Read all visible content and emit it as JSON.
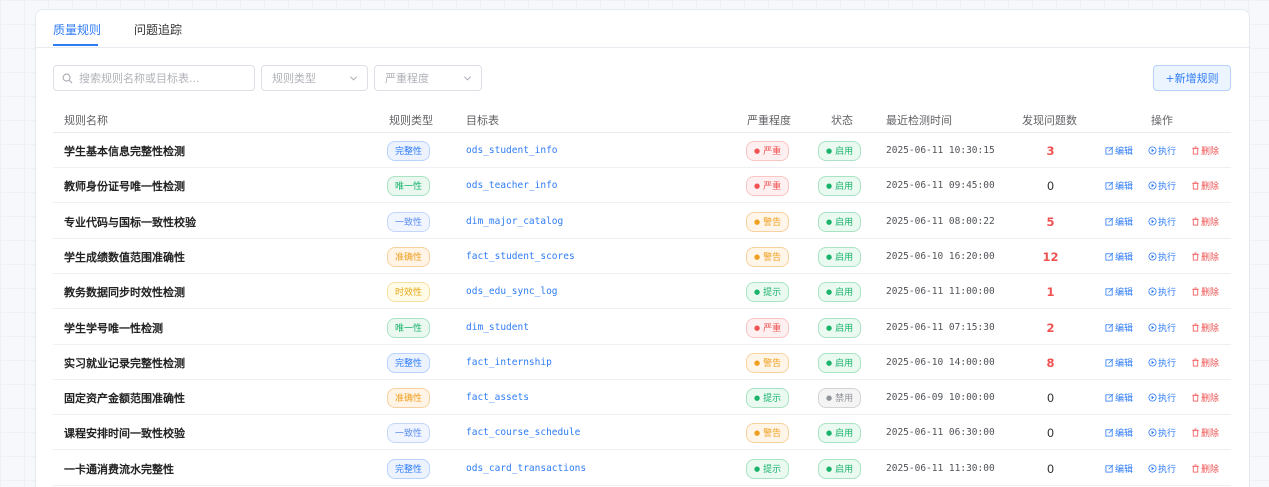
{
  "tabs": [
    {
      "label": "质量规则",
      "active": true
    },
    {
      "label": "问题追踪",
      "active": false
    }
  ],
  "toolbar": {
    "search_placeholder": "搜索规则名称或目标表...",
    "type_select_placeholder": "规则类型",
    "severity_select_placeholder": "严重程度",
    "add_button": "+新增规则"
  },
  "columns": [
    "规则名称",
    "规则类型",
    "目标表",
    "严重程度",
    "状态",
    "最近检测时间",
    "发现问题数",
    "操作"
  ],
  "actions": {
    "edit": "编辑",
    "run": "执行",
    "delete": "删除"
  },
  "colors": {
    "primary": "#2f7cf6",
    "danger": "#f05252",
    "warning": "#f0a020",
    "success": "#19b36b",
    "disabled": "#909399"
  },
  "rows": [
    {
      "name": "学生基本信息完整性检测",
      "type": "完整性",
      "table": "ods_student_info",
      "severity": "严重",
      "status": "启用",
      "time": "2025-06-11 10:30:15",
      "count": "3"
    },
    {
      "name": "教师身份证号唯一性检测",
      "type": "唯一性",
      "table": "ods_teacher_info",
      "severity": "严重",
      "status": "启用",
      "time": "2025-06-11 09:45:00",
      "count": "0"
    },
    {
      "name": "专业代码与国标一致性校验",
      "type": "一致性",
      "table": "dim_major_catalog",
      "severity": "警告",
      "status": "启用",
      "time": "2025-06-11 08:00:22",
      "count": "5"
    },
    {
      "name": "学生成绩数值范围准确性",
      "type": "准确性",
      "table": "fact_student_scores",
      "severity": "警告",
      "status": "启用",
      "time": "2025-06-10 16:20:00",
      "count": "12"
    },
    {
      "name": "教务数据同步时效性检测",
      "type": "时效性",
      "table": "ods_edu_sync_log",
      "severity": "提示",
      "status": "启用",
      "time": "2025-06-11 11:00:00",
      "count": "1"
    },
    {
      "name": "学生学号唯一性检测",
      "type": "唯一性",
      "table": "dim_student",
      "severity": "严重",
      "status": "启用",
      "time": "2025-06-11 07:15:30",
      "count": "2"
    },
    {
      "name": "实习就业记录完整性检测",
      "type": "完整性",
      "table": "fact_internship",
      "severity": "警告",
      "status": "启用",
      "time": "2025-06-10 14:00:00",
      "count": "8"
    },
    {
      "name": "固定资产金额范围准确性",
      "type": "准确性",
      "table": "fact_assets",
      "severity": "提示",
      "status": "禁用",
      "time": "2025-06-09 10:00:00",
      "count": "0"
    },
    {
      "name": "课程安排时间一致性校验",
      "type": "一致性",
      "table": "fact_course_schedule",
      "severity": "警告",
      "status": "启用",
      "time": "2025-06-11 06:30:00",
      "count": "0"
    },
    {
      "name": "一卡通消费流水完整性",
      "type": "完整性",
      "table": "ods_card_transactions",
      "severity": "提示",
      "status": "启用",
      "time": "2025-06-11 11:30:00",
      "count": "0"
    }
  ]
}
